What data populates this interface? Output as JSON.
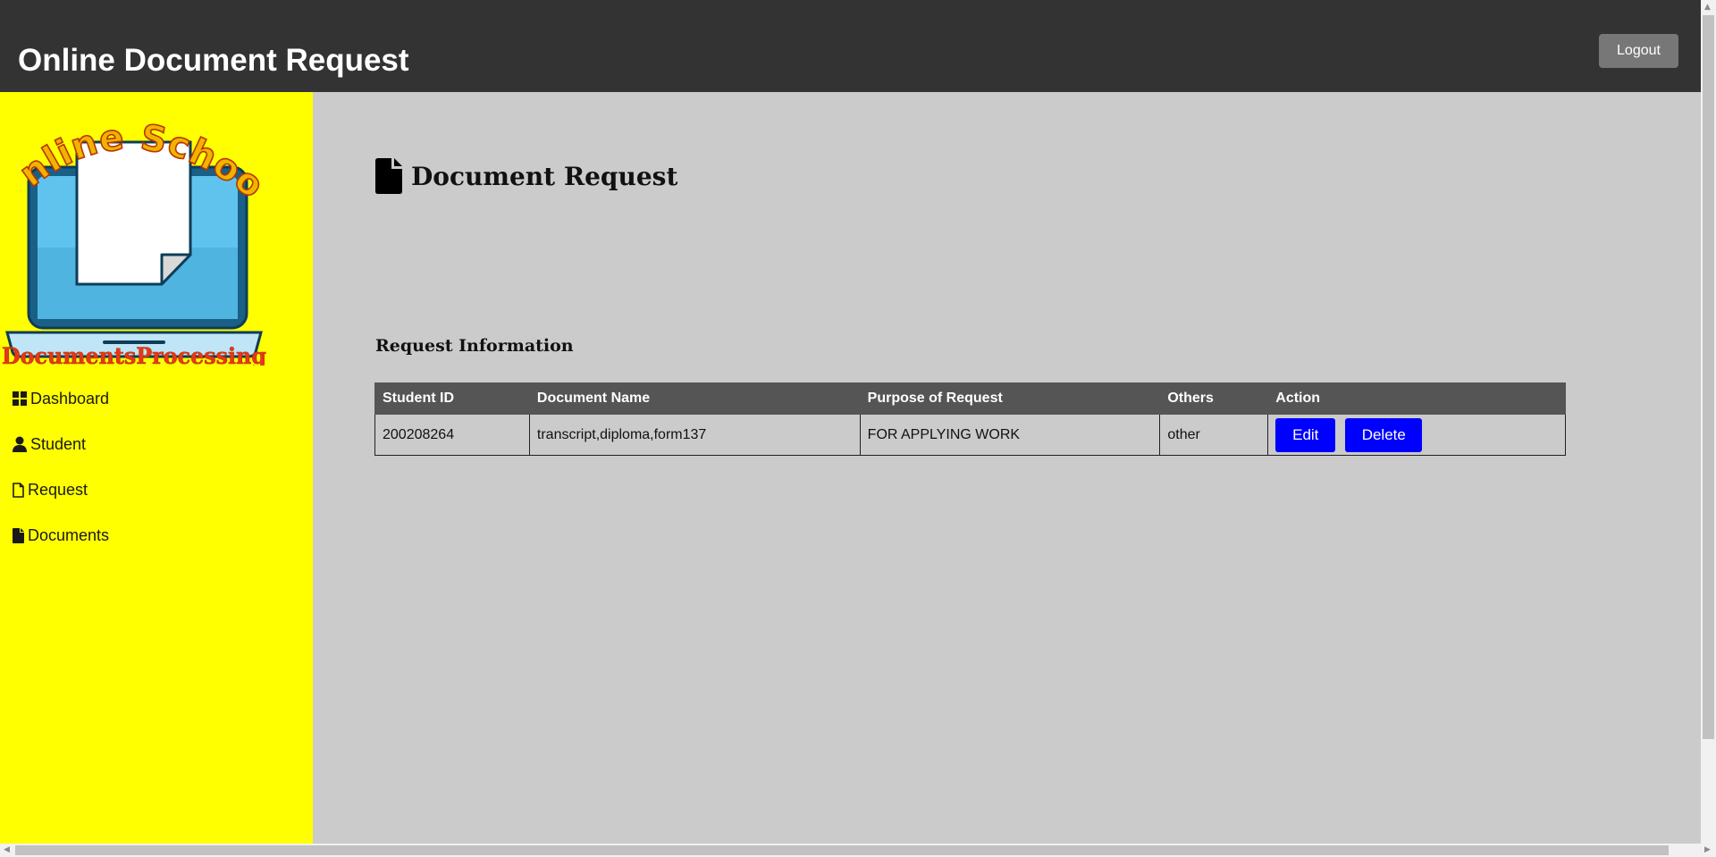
{
  "header": {
    "title": "Online Document Request",
    "logout_label": "Logout"
  },
  "logo": {
    "top_text": "Online School",
    "bottom_text": "DocumentsProcessing"
  },
  "sidebar": {
    "items": [
      {
        "label": "Dashboard",
        "icon": "dashboard-icon"
      },
      {
        "label": "Student",
        "icon": "user-icon"
      },
      {
        "label": "Request",
        "icon": "file-outline-icon"
      },
      {
        "label": "Documents",
        "icon": "file-icon"
      }
    ]
  },
  "main": {
    "page_title": "Document Request",
    "section_title": "Request Information",
    "table": {
      "columns": [
        "Student ID",
        "Document Name",
        "Purpose of Request",
        "Others",
        "Action"
      ],
      "rows": [
        {
          "student_id": "200208264",
          "document_name": "transcript,diploma,form137",
          "purpose": "FOR APPLYING WORK",
          "others": "other",
          "edit_label": "Edit",
          "delete_label": "Delete"
        }
      ]
    }
  },
  "colors": {
    "topbar": "#333333",
    "sidebar": "#ffff00",
    "main_bg": "#cbcbcb",
    "table_header": "#555555",
    "action_button": "#0000ff",
    "logout_button": "#777777"
  }
}
